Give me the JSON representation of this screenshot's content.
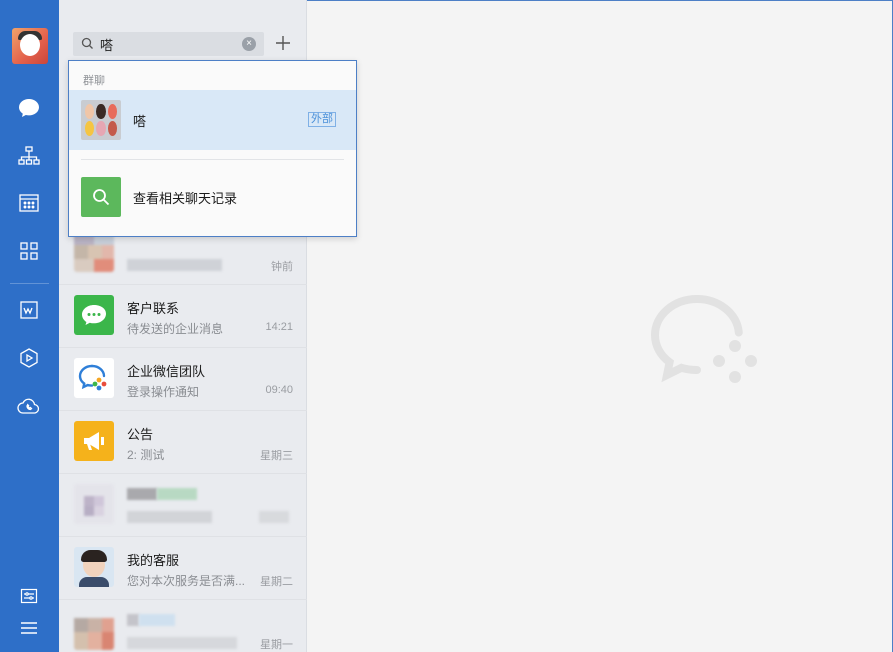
{
  "search": {
    "value": "嗒"
  },
  "dropdown": {
    "section_label": "群聊",
    "result": {
      "name": "嗒",
      "badge": "外部"
    },
    "action_label": "查看相关聊天记录"
  },
  "conversations": [
    {
      "title": "",
      "subtitle": "",
      "time": "钟前",
      "icon": "blurred-avatar"
    },
    {
      "title": "客户联系",
      "subtitle": "待发送的企业消息",
      "time": "14:21",
      "icon": "wechat-chat-icon"
    },
    {
      "title": "企业微信团队",
      "subtitle": "登录操作通知",
      "time": "09:40",
      "icon": "wecom-team-icon"
    },
    {
      "title": "公告",
      "subtitle": "2: 测试",
      "time": "星期三",
      "icon": "megaphone-icon"
    },
    {
      "title": "",
      "subtitle": "",
      "time": "",
      "icon": "blurred-avatar"
    },
    {
      "title": "我的客服",
      "subtitle": "您对本次服务是否满...",
      "time": "星期二",
      "icon": "service-avatar"
    },
    {
      "title": "",
      "subtitle": "",
      "time": "星期一",
      "icon": "blurred-avatar"
    }
  ],
  "colors": {
    "rail": "#2e6fc8",
    "highlight": "#d9e8f7",
    "green": "#5cb85c",
    "wechat_green": "#3bb64a",
    "announce_yellow": "#f5b21b"
  }
}
